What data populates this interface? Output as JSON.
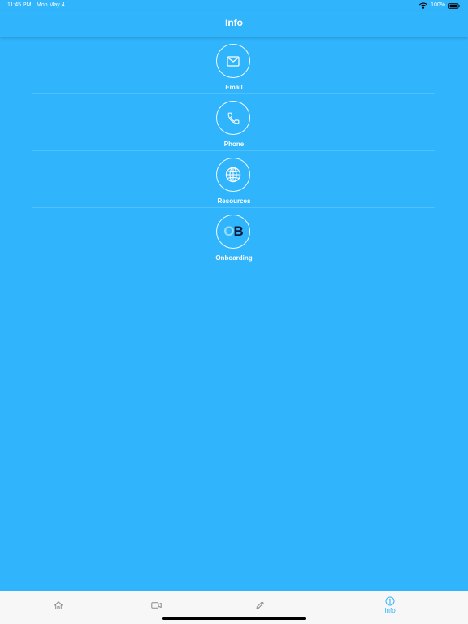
{
  "status_bar": {
    "time": "11:45 PM",
    "date": "Mon May 4",
    "battery": "100%"
  },
  "header": {
    "title": "Info"
  },
  "items": [
    {
      "label": "Email",
      "icon": "envelope-icon"
    },
    {
      "label": "Phone",
      "icon": "phone-icon"
    },
    {
      "label": "Resources",
      "icon": "globe-icon"
    },
    {
      "label": "Onboarding",
      "icon": "onboarding-logo",
      "logo_text": [
        "O",
        "B"
      ]
    }
  ],
  "tab_bar": {
    "tabs": [
      {
        "icon": "home-icon",
        "label": ""
      },
      {
        "icon": "video-icon",
        "label": ""
      },
      {
        "icon": "pencil-icon",
        "label": ""
      },
      {
        "icon": "info-icon",
        "label": "Info",
        "active": true
      }
    ]
  },
  "colors": {
    "background": "#30b4fc",
    "active_tab": "#30b4fc",
    "inactive_tab": "#8a8a8e",
    "tab_bar_bg": "#f7f7f7"
  }
}
